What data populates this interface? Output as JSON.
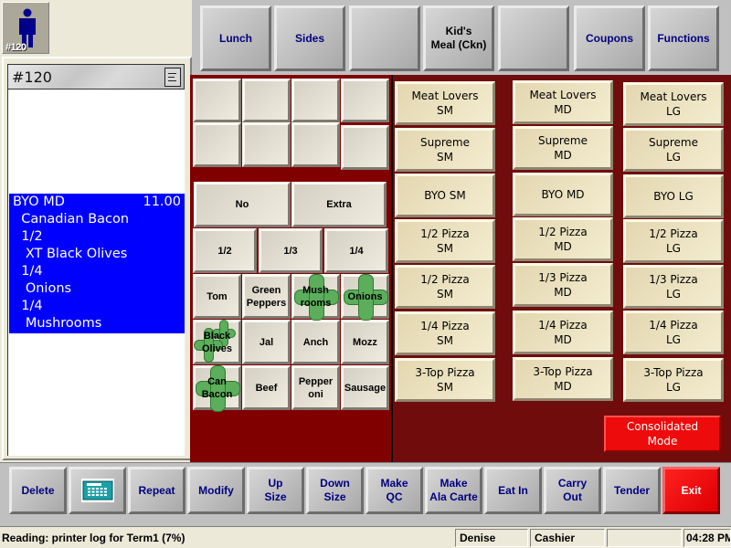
{
  "user_tile": {
    "icon": "person-icon",
    "label": "#120"
  },
  "check": {
    "number": "#120",
    "ticket_icon": "ticket-icon",
    "item": {
      "name": "BYO MD",
      "price": "11.00",
      "modifiers": [
        "  Canadian Bacon",
        "  1/2",
        "   XT Black Olives",
        "  1/4",
        "   Onions",
        "  1/4",
        "   Mushrooms"
      ]
    }
  },
  "top_bar": {
    "buttons": [
      {
        "label": "Lunch"
      },
      {
        "label": "Sides"
      },
      {
        "label": ""
      },
      {
        "label": "Kid's\nMeal (Ckn)"
      },
      {
        "label": ""
      },
      {
        "label": "Coupons"
      },
      {
        "label": "Functions"
      }
    ]
  },
  "modifiers": {
    "blank_grid_count": 8,
    "no_label": "No",
    "extra_label": "Extra",
    "portions": [
      "1/2",
      "1/3",
      "1/4"
    ],
    "toppings": [
      {
        "label": "Tom",
        "selected": false
      },
      {
        "label": "Green Peppers",
        "selected": false
      },
      {
        "label": "Mush rooms",
        "selected": true
      },
      {
        "label": "Onions",
        "selected": true
      },
      {
        "label": "Black Olives",
        "selected": true
      },
      {
        "label": "Jal",
        "selected": false
      },
      {
        "label": "Anch",
        "selected": false
      },
      {
        "label": "Mozz",
        "selected": false
      },
      {
        "label": "Can Bacon",
        "selected": true
      },
      {
        "label": "Beef",
        "selected": false
      },
      {
        "label": "Pepper oni",
        "selected": false
      },
      {
        "label": "Sausage",
        "selected": false
      }
    ]
  },
  "pizzas": {
    "columns": [
      [
        "Meat Lovers\nSM",
        "Supreme\nSM",
        "BYO SM",
        "1/2 Pizza\nSM",
        "1/2 Pizza\nSM",
        "1/4 Pizza\nSM",
        "3-Top Pizza\nSM"
      ],
      [
        "Meat Lovers\nMD",
        "Supreme\nMD",
        "BYO MD",
        "1/2 Pizza\nMD",
        "1/3 Pizza\nMD",
        "1/4 Pizza\nMD",
        "3-Top Pizza\nMD"
      ],
      [
        "Meat Lovers\nLG",
        "Supreme\nLG",
        "BYO LG",
        "1/2 Pizza\nLG",
        "1/3 Pizza\nLG",
        "1/4 Pizza\nLG",
        "3-Top Pizza\nLG"
      ]
    ],
    "consolidated_label": "Consolidated\nMode"
  },
  "bottom_bar": {
    "buttons": [
      {
        "label": "Delete"
      },
      {
        "label": "",
        "icon": "keypad-icon"
      },
      {
        "label": "Repeat"
      },
      {
        "label": "Modify"
      },
      {
        "label": "Up\nSize"
      },
      {
        "label": "Down\nSize"
      },
      {
        "label": "Make\nQC"
      },
      {
        "label": "Make\nAla Carte"
      },
      {
        "label": "Eat In"
      },
      {
        "label": "Carry\nOut"
      },
      {
        "label": "Tender"
      },
      {
        "label": "Exit"
      }
    ]
  },
  "status_bar": {
    "message": "Reading: printer log for Term1 (7%)",
    "employee": "Denise",
    "role": "Cashier",
    "extra": "",
    "time": "04:28 PM"
  },
  "colors": {
    "selected_row": "#0000ff",
    "exit": "#e60b0b",
    "nav_text": "#000080",
    "panel_bg": "#800000"
  }
}
